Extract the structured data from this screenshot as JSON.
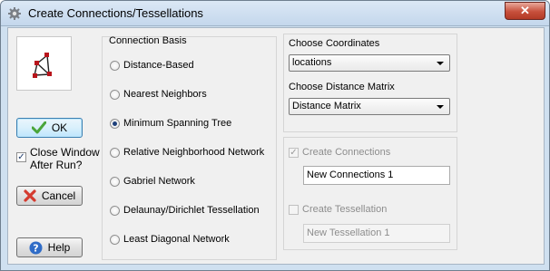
{
  "window": {
    "title": "Create Connections/Tessellations",
    "close_label": "✕"
  },
  "icons": {
    "app": "app-gear-icon",
    "graph": "connection-graph-icon",
    "ok": "checkmark-icon",
    "cancel": "x-mark-icon",
    "help": "help-question-icon"
  },
  "left": {
    "ok_label": "OK",
    "close_after_run": {
      "label_line1": "Close Window",
      "label_line2": "After Run?",
      "checked": true
    },
    "cancel_label": "Cancel",
    "help_label": "Help"
  },
  "basis": {
    "heading": "Connection Basis",
    "selected_index": 2,
    "options": [
      "Distance-Based",
      "Nearest Neighbors",
      "Minimum Spanning Tree",
      "Relative Neighborhood Network",
      "Gabriel Network",
      "Delaunay/Dirichlet Tessellation",
      "Least Diagonal Network"
    ]
  },
  "coords": {
    "label": "Choose Coordinates",
    "value": "locations"
  },
  "matrix": {
    "label": "Choose Distance Matrix",
    "value": "Distance Matrix"
  },
  "create_connections": {
    "label": "Create Connections",
    "checked": true,
    "enabled": false,
    "name_value": "New Connections 1"
  },
  "create_tessellation": {
    "label": "Create Tessellation",
    "checked": false,
    "enabled": false,
    "name_value": "New Tessellation 1"
  },
  "colors": {
    "ok_border": "#3c7fb1",
    "close_red": "#c7503c",
    "radio_selected": "#1d3f7a",
    "cancel_red": "#d43b2f",
    "help_blue": "#2f6cc7",
    "check_green": "#4aa53a"
  }
}
